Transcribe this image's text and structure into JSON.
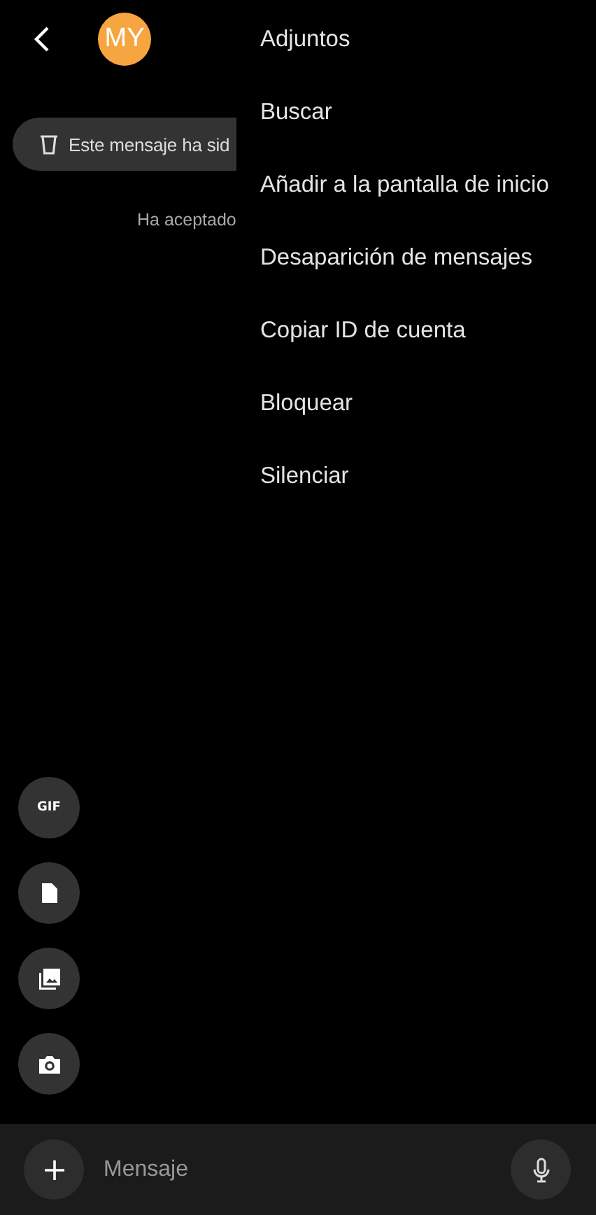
{
  "header": {
    "avatar_initials": "MY"
  },
  "messages": [
    {
      "kind": "deleted",
      "text": "Este mensaje ha sid"
    },
    {
      "kind": "notice",
      "text": "Ha aceptado"
    }
  ],
  "menu": {
    "items": [
      {
        "label": "Adjuntos"
      },
      {
        "label": "Buscar"
      },
      {
        "label": "Añadir a la pantalla de inicio"
      },
      {
        "label": "Desaparición de mensajes"
      },
      {
        "label": "Copiar ID de cuenta"
      },
      {
        "label": "Bloquear"
      },
      {
        "label": "Silenciar"
      }
    ]
  },
  "attachments": [
    {
      "kind": "gif",
      "label": "GIF"
    },
    {
      "kind": "file"
    },
    {
      "kind": "gallery"
    },
    {
      "kind": "camera"
    }
  ],
  "composer": {
    "placeholder": "Mensaje"
  }
}
